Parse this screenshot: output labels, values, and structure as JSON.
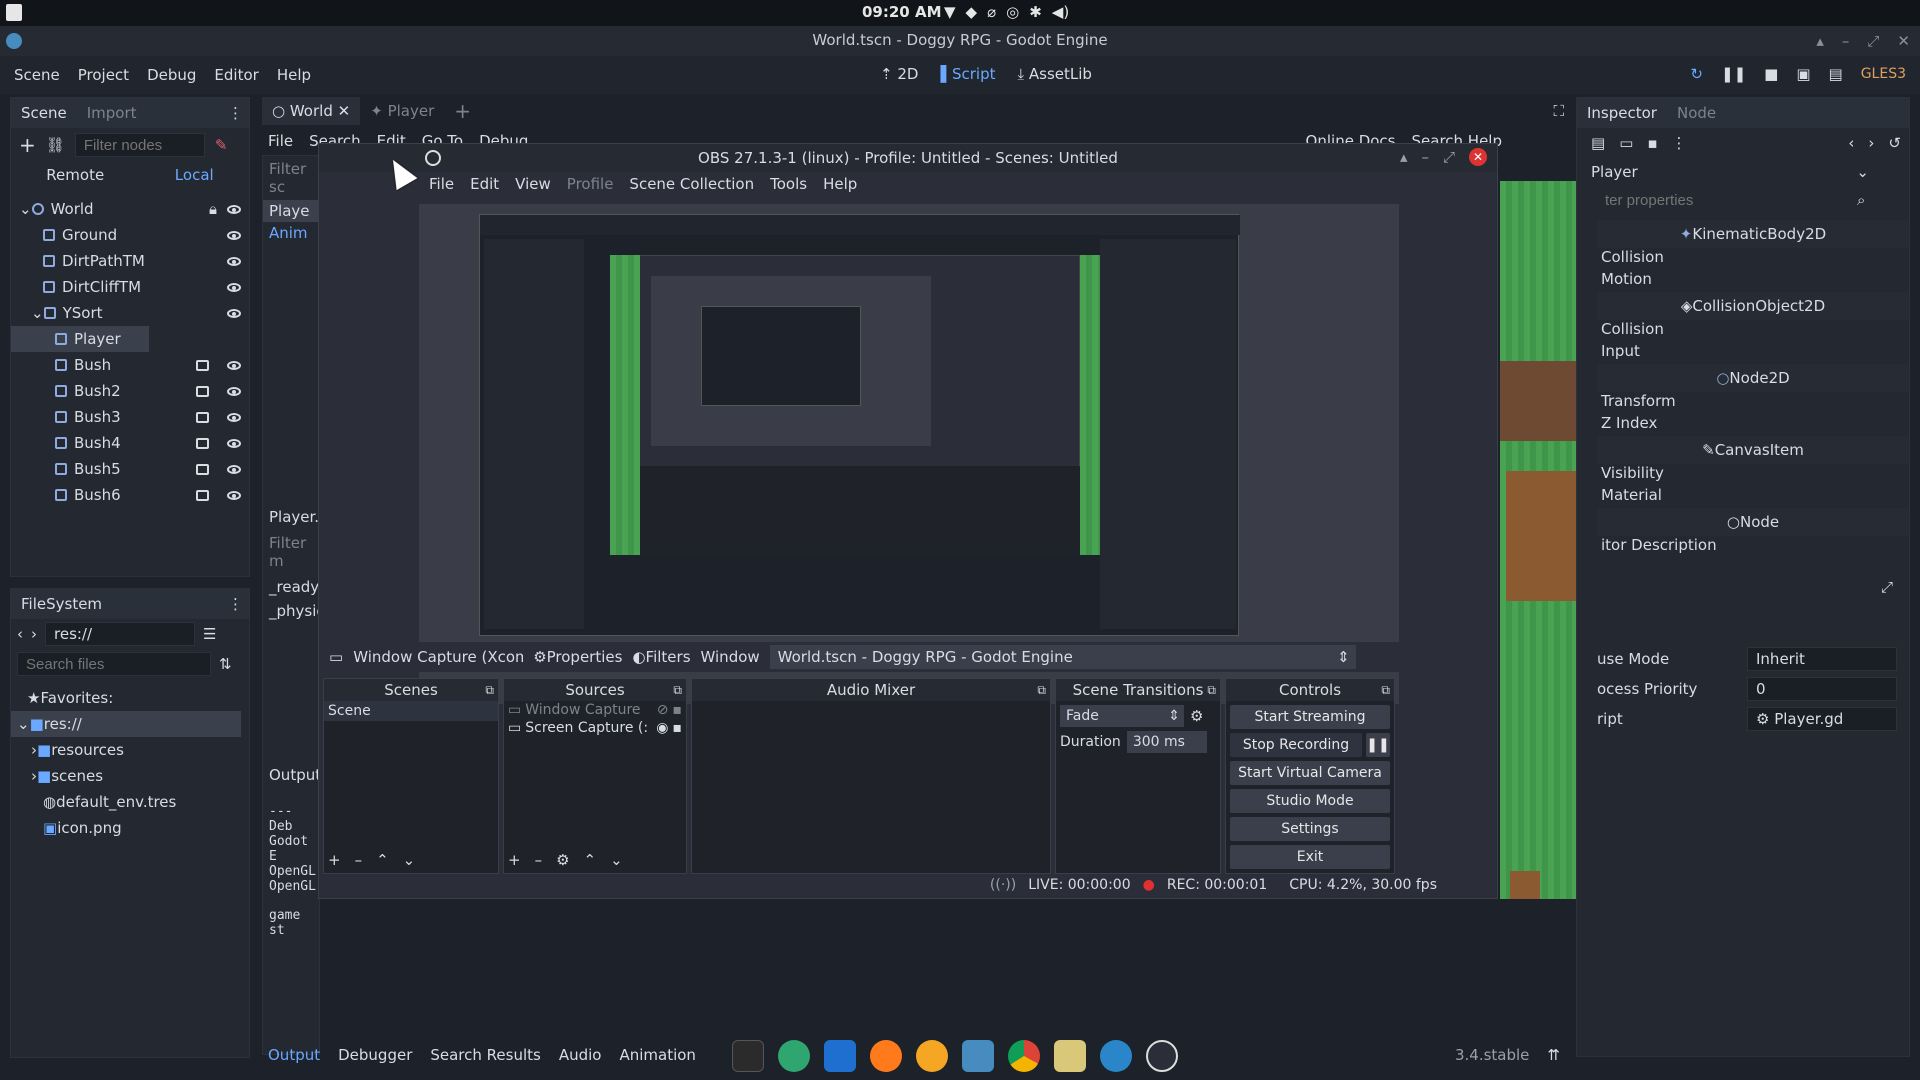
{
  "system": {
    "time": "09:20 AM"
  },
  "window": {
    "title": "World.tscn - Doggy RPG - Godot Engine"
  },
  "menu": {
    "items": [
      "Scene",
      "Project",
      "Debug",
      "Editor",
      "Help"
    ]
  },
  "toolbar": {
    "mode_2d": "2D",
    "mode_script": "Script",
    "mode_assetlib": "AssetLib",
    "renderer": "GLES3"
  },
  "scene_dock": {
    "tab_scene": "Scene",
    "tab_import": "Import",
    "filter_placeholder": "Filter nodes",
    "remote": "Remote",
    "local": "Local",
    "nodes": [
      {
        "label": "World",
        "level": 0
      },
      {
        "label": "Ground",
        "level": 1
      },
      {
        "label": "DirtPathTM",
        "level": 1
      },
      {
        "label": "DirtCliffTM",
        "level": 1
      },
      {
        "label": "YSort",
        "level": 1
      },
      {
        "label": "Player",
        "level": 2
      },
      {
        "label": "Bush",
        "level": 2
      },
      {
        "label": "Bush2",
        "level": 2
      },
      {
        "label": "Bush3",
        "level": 2
      },
      {
        "label": "Bush4",
        "level": 2
      },
      {
        "label": "Bush5",
        "level": 2
      },
      {
        "label": "Bush6",
        "level": 2
      }
    ]
  },
  "filesystem": {
    "title": "FileSystem",
    "path": "res://",
    "search_placeholder": "Search files",
    "items": [
      "Favorites:",
      "res://",
      "resources",
      "scenes",
      "default_env.tres",
      "icon.png"
    ]
  },
  "editor_tabs": {
    "world": "World",
    "player": "Player"
  },
  "script_menu": {
    "items": [
      "File",
      "Search",
      "Edit",
      "Go To",
      "Debug"
    ],
    "online_docs": "Online Docs",
    "search_help": "Search Help"
  },
  "script_panel": {
    "filter_scripts": "Filter sc",
    "script_item": "Playe",
    "script_item2": "Anim",
    "file_label": "Player.g",
    "filter_methods": "Filter m",
    "methods": [
      "_ready",
      "_physics"
    ]
  },
  "output": {
    "label": "Output:",
    "lines": [
      "--- Deb",
      "Godot E",
      "OpenGL",
      "OpenGL",
      "",
      "game st"
    ]
  },
  "bottom_tabs": [
    "Output",
    "Debugger",
    "Search Results",
    "Audio",
    "Animation"
  ],
  "version": "3.4.stable",
  "inspector": {
    "tab_inspector": "Inspector",
    "tab_node": "Node",
    "object": "Player",
    "filter_placeholder": "ter properties",
    "sections": [
      {
        "header": "KinematicBody2D",
        "props": [
          "Collision",
          "Motion"
        ]
      },
      {
        "header": "CollisionObject2D",
        "props": [
          "Collision",
          "Input"
        ]
      },
      {
        "header": "Node2D",
        "props": [
          "Transform",
          "Z Index"
        ]
      },
      {
        "header": "CanvasItem",
        "props": [
          "Visibility",
          "Material"
        ]
      },
      {
        "header": "Node",
        "props": [
          "itor Description"
        ]
      }
    ],
    "pause_mode_label": "use Mode",
    "pause_mode_value": "Inherit",
    "process_priority_label": "ocess Priority",
    "process_priority_value": "0",
    "script_label": "ript",
    "script_value": "Player.gd"
  },
  "obs": {
    "title": "OBS 27.1.3-1 (linux) - Profile: Untitled - Scenes: Untitled",
    "menu": [
      "File",
      "Edit",
      "View",
      "Profile",
      "Scene Collection",
      "Tools",
      "Help"
    ],
    "source_bar": {
      "source": "Window Capture (Xcomp",
      "properties": "Properties",
      "filters": "Filters",
      "window_label": "Window",
      "window_value": "World.tscn - Doggy RPG - Godot Engine"
    },
    "docks": {
      "scenes": "Scenes",
      "sources": "Sources",
      "mixer": "Audio Mixer",
      "transitions": "Scene Transitions",
      "controls": "Controls"
    },
    "scene_items": [
      "Scene"
    ],
    "source_items": [
      "Window Capture",
      "Screen Capture (:"
    ],
    "transition": {
      "value": "Fade",
      "duration_label": "Duration",
      "duration_value": "300 ms"
    },
    "controls": [
      "Start Streaming",
      "Stop Recording",
      "Start Virtual Camera",
      "Studio Mode",
      "Settings",
      "Exit"
    ],
    "status": {
      "live": "LIVE: 00:00:00",
      "rec": "REC: 00:00:01",
      "cpu": "CPU: 4.2%, 30.00 fps"
    }
  },
  "colors": {
    "accent": "#6aa9ff",
    "obs_bg": "#2b2e38",
    "godot_bg": "#1d2129",
    "grass": "#3b9c4b",
    "dirt": "#8c5a31"
  }
}
